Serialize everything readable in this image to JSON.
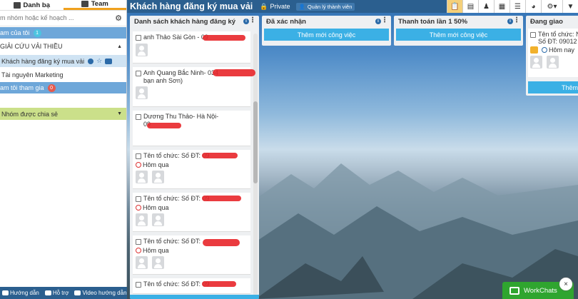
{
  "sidebar": {
    "tabs": [
      {
        "label": "Danh bạ",
        "icon": "contacts-icon"
      },
      {
        "label": "Team",
        "icon": "team-icon"
      }
    ],
    "search_placeholder": "m nhóm hoặc kế hoạch ...",
    "items": [
      {
        "label": "am của tôi",
        "badge": "1"
      },
      {
        "label": "GIẢI CỨU VẢI THIỀU"
      },
      {
        "label": "Khách hàng đăng ký mua vải"
      },
      {
        "label": "Tài nguyên Marketing"
      },
      {
        "label": "am tôi tham gia",
        "badge": "0"
      },
      {
        "label": "Nhóm được chia sẻ"
      }
    ],
    "footer": [
      "Hướng dẫn",
      "Hỗ trợ",
      "Video hướng dẫn"
    ]
  },
  "board": {
    "title": "Khách hàng đăng ký mua vải",
    "privacy": "Private",
    "members_button": "Quản lý thành viên"
  },
  "columns": [
    {
      "title": "Danh sách khách hàng đăng ký",
      "cards": [
        {
          "text": "anh Thảo Sài Gòn - 09"
        },
        {
          "text": "Anh Quang Bắc Ninh- 034",
          "text2": "bạn anh Sơn)"
        },
        {
          "text": "Dương Thu Thảo- Hà Nội-",
          "text2": "09"
        },
        {
          "text": "Tên tổ chức: Số ĐT: 09",
          "date": "Hôm qua"
        },
        {
          "text": "Tên tổ chức: Số ĐT: 09",
          "date": "Hôm qua"
        },
        {
          "text": "Tên tổ chức: Số ĐT:",
          "date": "Hôm qua"
        },
        {
          "text": "Tên tổ chức: Số ĐT: 09"
        }
      ]
    },
    {
      "title": "Đã xác nhận",
      "add_label": "Thêm mới công việc"
    },
    {
      "title": "Thanh toán lần 1 50%",
      "add_label": "Thêm mới công việc"
    },
    {
      "title": "Đang giao",
      "add_label": "Thêm",
      "card": {
        "line1": "Tên tổ chức: N",
        "line2": "Số ĐT: 09012",
        "date": "Hôm nay"
      }
    }
  ],
  "workchats": "WorkChats",
  "close_label": "×"
}
